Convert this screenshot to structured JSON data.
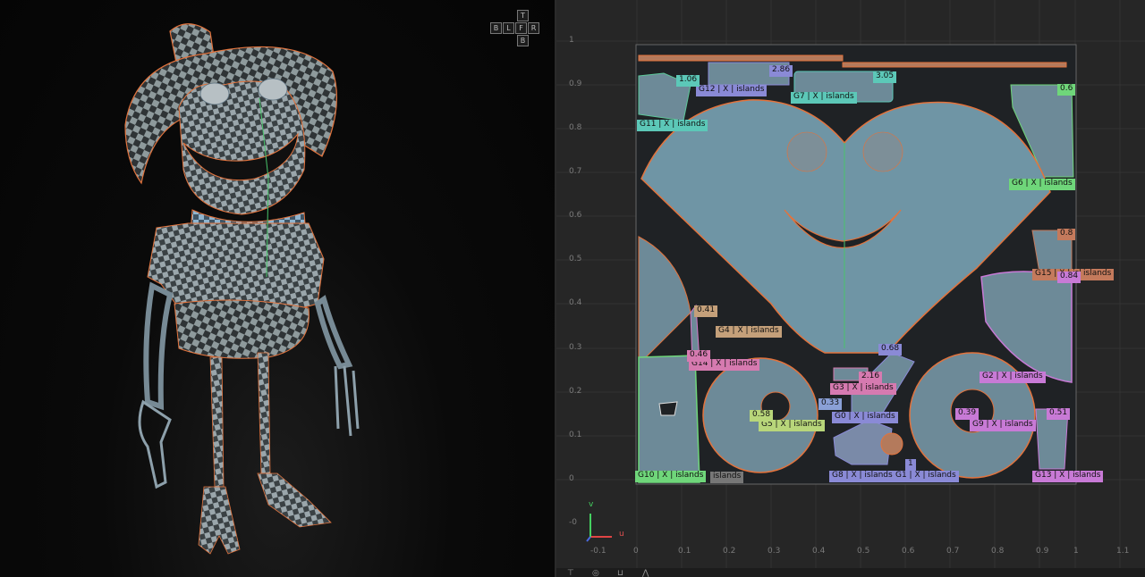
{
  "view_cube": {
    "top": "T",
    "left": "B",
    "l": "L",
    "front": "F",
    "right": "R",
    "bottom": "B"
  },
  "uv_editor": {
    "y_ticks": [
      "1",
      "0.9",
      "0.8",
      "0.7",
      "0.6",
      "0.5",
      "0.4",
      "0.3",
      "0.2",
      "0.1",
      "0",
      "-0"
    ],
    "x_ticks": [
      "-0.1",
      "0",
      "0.1",
      "0.2",
      "0.3",
      "0.4",
      "0.5",
      "0.6",
      "0.7",
      "0.8",
      "0.9",
      "1",
      "1.1"
    ],
    "axis_u": "u",
    "axis_v": "v",
    "groups": [
      {
        "id": "G12",
        "x": "X",
        "label": "islands",
        "value": "2.86"
      },
      {
        "id": "G11",
        "x": "X",
        "label": "islands",
        "value": "1.06"
      },
      {
        "id": "G7",
        "x": "X",
        "label": "islands",
        "value": "3.05"
      },
      {
        "id": "G6",
        "x": "X",
        "label": "islands",
        "value": "0.6"
      },
      {
        "id": "G15",
        "x": "X",
        "label": "islands",
        "value": "0.8"
      },
      {
        "id": "G4",
        "x": "X",
        "label": "islands",
        "value": "0.41"
      },
      {
        "id": "G14",
        "x": "X",
        "label": "islands",
        "value": "0.46"
      },
      {
        "id": "G3",
        "x": "X",
        "label": "islands",
        "value": "2.16"
      },
      {
        "id": "G2",
        "x": "X",
        "label": "islands",
        "value": "0.84"
      },
      {
        "id": "G0",
        "x": "X",
        "label": "islands",
        "value": "0.68"
      },
      {
        "id": "G5",
        "x": "X",
        "label": "islands",
        "value": "0.58"
      },
      {
        "id": "G9",
        "x": "X",
        "label": "islands",
        "value": "0.39"
      },
      {
        "id": "G10",
        "x": "X",
        "label": "islands",
        "value": ""
      },
      {
        "id": "G8",
        "x": "X",
        "label": "islands",
        "value": ""
      },
      {
        "id": "G1",
        "x": "X",
        "label": "islands",
        "value": "1"
      },
      {
        "id": "G13",
        "x": "X",
        "label": "islands",
        "value": "0.51"
      }
    ],
    "extra_values": [
      "0.33"
    ],
    "extra_label": "islands"
  },
  "colors": {
    "viewport_bg": "#0a0a0a",
    "uv_bg": "#262626",
    "seam": "#e2733d",
    "uv_fill": "#6b8fa0"
  }
}
